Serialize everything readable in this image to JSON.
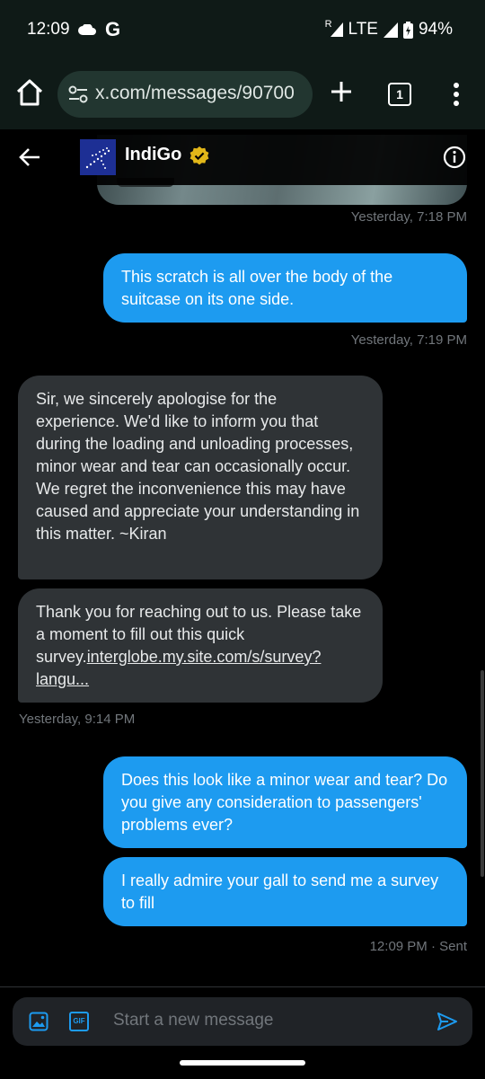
{
  "status_bar": {
    "time": "12:09",
    "g_glyph": "G",
    "roaming": "R",
    "network": "LTE",
    "battery": "94%"
  },
  "browser": {
    "url": "x.com/messages/90700",
    "tab_count": "1"
  },
  "chat": {
    "name": "IndiGo",
    "verified": true
  },
  "messages": [
    {
      "side": "timestamp",
      "text": "Yesterday, 7:18 PM"
    },
    {
      "side": "sent",
      "text": "This scratch is all over the body of the suitcase on its one side."
    },
    {
      "side": "timestamp",
      "text": "Yesterday, 7:19 PM"
    },
    {
      "side": "received",
      "text": "Sir, we sincerely apologise for the experience. We'd like to inform you that during the loading and unloading processes, minor wear and tear can occasionally occur. We regret the inconvenience this may have caused and appreciate your understanding in this matter. ~Kiran"
    },
    {
      "side": "received",
      "text_prefix": "Thank you for reaching out to us. Please take a moment to fill out this quick survey.",
      "link": "interglobe.my.site.com/s/survey?langu..."
    },
    {
      "side": "timestamp",
      "text": "Yesterday, 9:14 PM"
    },
    {
      "side": "sent",
      "text": "Does this look like a minor wear and tear? Do you give any consideration to passengers' problems ever?"
    },
    {
      "side": "sent",
      "text": "I really admire your gall to send me a survey to fill"
    },
    {
      "side": "timestamp",
      "text": "12:09 PM · Sent"
    }
  ],
  "composer": {
    "placeholder": "Start a new message",
    "gif_label": "GIF"
  },
  "colors": {
    "accent": "#1d9bf0",
    "received_bubble": "#2f3336",
    "background": "#000000",
    "browser_bar": "#0f1a17",
    "url_pill": "#223630",
    "verified_gold": "#e2b719"
  }
}
